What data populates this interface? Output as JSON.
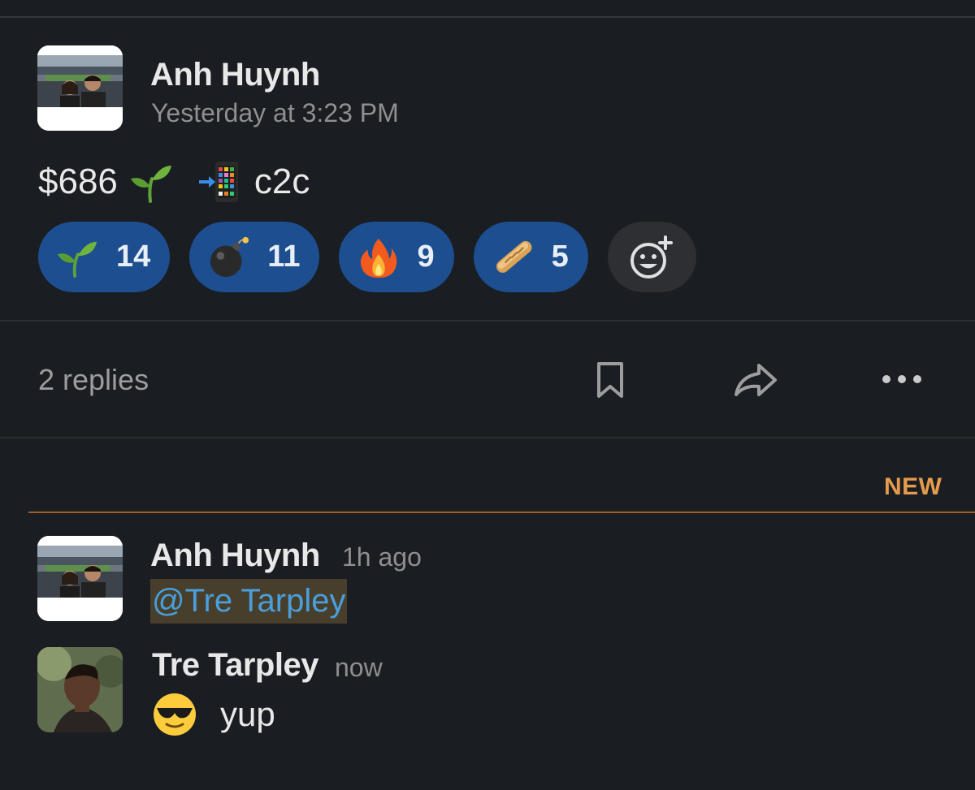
{
  "post": {
    "author": "Anh Huynh",
    "timestamp": "Yesterday at 3:23 PM",
    "text_amount": "$686",
    "text_emoji_1": "seedling-emoji",
    "text_emoji_2": "phone-arrow-emoji",
    "text_suffix": "c2c",
    "reactions": [
      {
        "emoji": "seedling-emoji",
        "count": "14"
      },
      {
        "emoji": "bomb-emoji",
        "count": "11"
      },
      {
        "emoji": "fire-emoji",
        "count": "9"
      },
      {
        "emoji": "baguette-emoji",
        "count": "5"
      }
    ],
    "add_reaction_icon": "add-reaction-icon"
  },
  "thread_bar": {
    "replies_label": "2 replies",
    "icons": [
      "bookmark-icon",
      "share-arrow-icon",
      "more-dots-icon"
    ]
  },
  "new_divider": {
    "label": "NEW",
    "color": "#e59b4c"
  },
  "replies": [
    {
      "author": "Anh Huynh",
      "time": "1h ago",
      "mention": "@Tre Tarpley"
    },
    {
      "author": "Tre Tarpley",
      "time": "now",
      "emoji": "sunglasses-emoji",
      "text": "yup"
    }
  ],
  "colors": {
    "background": "#1a1d21",
    "reaction_pill": "#1d4e8f",
    "mention_text": "#4a9edb",
    "mention_bg": "#473f2c"
  }
}
